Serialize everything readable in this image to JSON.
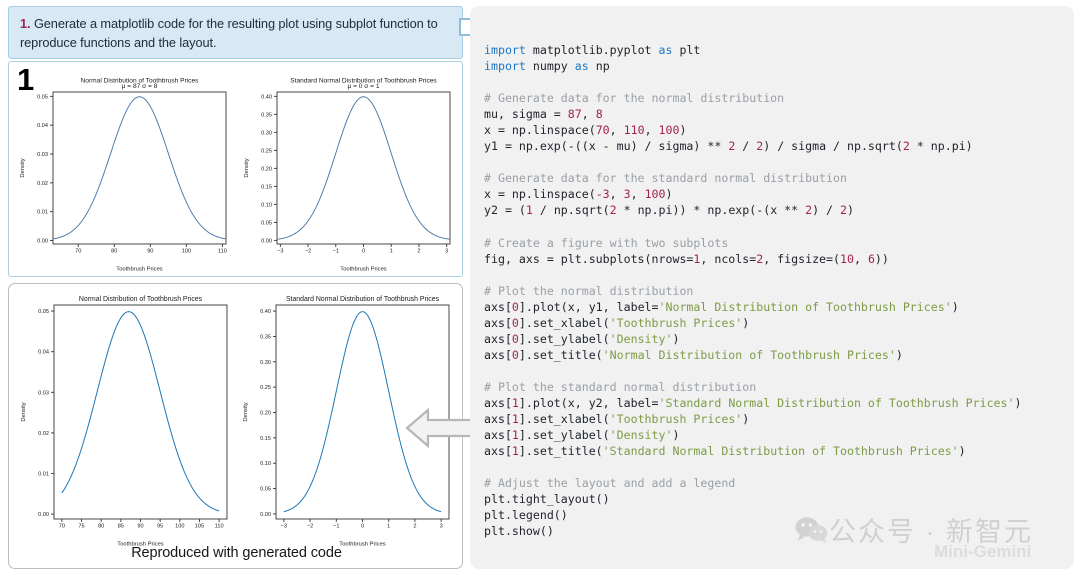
{
  "prompt": {
    "number": "1.",
    "text": " Generate a matplotlib code for the resulting plot using subplot function to reproduce functions and the layout."
  },
  "original_panel": {
    "badge": "1"
  },
  "reproduced_panel": {
    "caption": "Reproduced with generated code"
  },
  "arrows": {
    "right_arrow": "arrow-right-icon",
    "left_arrow": "arrow-left-icon"
  },
  "watermark": {
    "icon": "wechat-icon",
    "main": "公众号 · 新智元",
    "sub": "Mini-Gemini"
  },
  "code": {
    "language": "python",
    "lines": [
      [
        {
          "t": "import",
          "c": "kw"
        },
        {
          "t": " matplotlib.pyplot ",
          "c": "fn"
        },
        {
          "t": "as",
          "c": "kw"
        },
        {
          "t": " plt",
          "c": "fn"
        }
      ],
      [
        {
          "t": "import",
          "c": "kw"
        },
        {
          "t": " numpy ",
          "c": "fn"
        },
        {
          "t": "as",
          "c": "kw"
        },
        {
          "t": " np",
          "c": "fn"
        }
      ],
      [],
      [
        {
          "t": "# Generate data for the normal distribution",
          "c": "cmt"
        }
      ],
      [
        {
          "t": "mu, sigma = ",
          "c": "fn"
        },
        {
          "t": "87",
          "c": "num"
        },
        {
          "t": ", ",
          "c": "fn"
        },
        {
          "t": "8",
          "c": "num"
        }
      ],
      [
        {
          "t": "x = np.linspace(",
          "c": "fn"
        },
        {
          "t": "70",
          "c": "num"
        },
        {
          "t": ", ",
          "c": "fn"
        },
        {
          "t": "110",
          "c": "num"
        },
        {
          "t": ", ",
          "c": "fn"
        },
        {
          "t": "100",
          "c": "num"
        },
        {
          "t": ")",
          "c": "fn"
        }
      ],
      [
        {
          "t": "y1 = np.exp(-((x - mu) / sigma) ** ",
          "c": "fn"
        },
        {
          "t": "2",
          "c": "num"
        },
        {
          "t": " / ",
          "c": "fn"
        },
        {
          "t": "2",
          "c": "num"
        },
        {
          "t": ") / sigma / np.sqrt(",
          "c": "fn"
        },
        {
          "t": "2",
          "c": "num"
        },
        {
          "t": " * np.pi)",
          "c": "fn"
        }
      ],
      [],
      [
        {
          "t": "# Generate data for the standard normal distribution",
          "c": "cmt"
        }
      ],
      [
        {
          "t": "x = np.linspace(",
          "c": "fn"
        },
        {
          "t": "-3",
          "c": "num"
        },
        {
          "t": ", ",
          "c": "fn"
        },
        {
          "t": "3",
          "c": "num"
        },
        {
          "t": ", ",
          "c": "fn"
        },
        {
          "t": "100",
          "c": "num"
        },
        {
          "t": ")",
          "c": "fn"
        }
      ],
      [
        {
          "t": "y2 = (",
          "c": "fn"
        },
        {
          "t": "1",
          "c": "num"
        },
        {
          "t": " / np.sqrt(",
          "c": "fn"
        },
        {
          "t": "2",
          "c": "num"
        },
        {
          "t": " * np.pi)) * np.exp(-(x ** ",
          "c": "fn"
        },
        {
          "t": "2",
          "c": "num"
        },
        {
          "t": ") / ",
          "c": "fn"
        },
        {
          "t": "2",
          "c": "num"
        },
        {
          "t": ")",
          "c": "fn"
        }
      ],
      [],
      [
        {
          "t": "# Create a figure with two subplots",
          "c": "cmt"
        }
      ],
      [
        {
          "t": "fig, axs = plt.subplots(nrows=",
          "c": "fn"
        },
        {
          "t": "1",
          "c": "num"
        },
        {
          "t": ", ncols=",
          "c": "fn"
        },
        {
          "t": "2",
          "c": "num"
        },
        {
          "t": ", figsize=(",
          "c": "fn"
        },
        {
          "t": "10",
          "c": "num"
        },
        {
          "t": ", ",
          "c": "fn"
        },
        {
          "t": "6",
          "c": "num"
        },
        {
          "t": "))",
          "c": "fn"
        }
      ],
      [],
      [
        {
          "t": "# Plot the normal distribution",
          "c": "cmt"
        }
      ],
      [
        {
          "t": "axs[",
          "c": "fn"
        },
        {
          "t": "0",
          "c": "num"
        },
        {
          "t": "].plot(x, y1, label=",
          "c": "fn"
        },
        {
          "t": "'Normal Distribution of Toothbrush Prices'",
          "c": "str"
        },
        {
          "t": ")",
          "c": "fn"
        }
      ],
      [
        {
          "t": "axs[",
          "c": "fn"
        },
        {
          "t": "0",
          "c": "num"
        },
        {
          "t": "].set_xlabel(",
          "c": "fn"
        },
        {
          "t": "'Toothbrush Prices'",
          "c": "str"
        },
        {
          "t": ")",
          "c": "fn"
        }
      ],
      [
        {
          "t": "axs[",
          "c": "fn"
        },
        {
          "t": "0",
          "c": "num"
        },
        {
          "t": "].set_ylabel(",
          "c": "fn"
        },
        {
          "t": "'Density'",
          "c": "str"
        },
        {
          "t": ")",
          "c": "fn"
        }
      ],
      [
        {
          "t": "axs[",
          "c": "fn"
        },
        {
          "t": "0",
          "c": "num"
        },
        {
          "t": "].set_title(",
          "c": "fn"
        },
        {
          "t": "'Normal Distribution of Toothbrush Prices'",
          "c": "str"
        },
        {
          "t": ")",
          "c": "fn"
        }
      ],
      [],
      [
        {
          "t": "# Plot the standard normal distribution",
          "c": "cmt"
        }
      ],
      [
        {
          "t": "axs[",
          "c": "fn"
        },
        {
          "t": "1",
          "c": "num"
        },
        {
          "t": "].plot(x, y2, label=",
          "c": "fn"
        },
        {
          "t": "'Standard Normal Distribution of Toothbrush Prices'",
          "c": "str"
        },
        {
          "t": ")",
          "c": "fn"
        }
      ],
      [
        {
          "t": "axs[",
          "c": "fn"
        },
        {
          "t": "1",
          "c": "num"
        },
        {
          "t": "].set_xlabel(",
          "c": "fn"
        },
        {
          "t": "'Toothbrush Prices'",
          "c": "str"
        },
        {
          "t": ")",
          "c": "fn"
        }
      ],
      [
        {
          "t": "axs[",
          "c": "fn"
        },
        {
          "t": "1",
          "c": "num"
        },
        {
          "t": "].set_ylabel(",
          "c": "fn"
        },
        {
          "t": "'Density'",
          "c": "str"
        },
        {
          "t": ")",
          "c": "fn"
        }
      ],
      [
        {
          "t": "axs[",
          "c": "fn"
        },
        {
          "t": "1",
          "c": "num"
        },
        {
          "t": "].set_title(",
          "c": "fn"
        },
        {
          "t": "'Standard Normal Distribution of Toothbrush Prices'",
          "c": "str"
        },
        {
          "t": ")",
          "c": "fn"
        }
      ],
      [],
      [
        {
          "t": "# Adjust the layout and add a legend",
          "c": "cmt"
        }
      ],
      [
        {
          "t": "plt.tight_layout()",
          "c": "fn"
        }
      ],
      [
        {
          "t": "plt.legend()",
          "c": "fn"
        }
      ],
      [
        {
          "t": "plt.show()",
          "c": "fn"
        }
      ]
    ]
  },
  "chart_data": [
    {
      "id": "orig-normal",
      "type": "line",
      "title": "Normal Distribution of Toothbrush Prices",
      "subtitle": "μ = 87 σ = 8",
      "xlabel": "Toothbrush Prices",
      "ylabel": "Density",
      "line_color": "#4878a8",
      "grid": false,
      "xlim": [
        63,
        111
      ],
      "ylim": [
        -0.0012,
        0.0515
      ],
      "xticks": [
        70,
        80,
        90,
        100,
        110
      ],
      "xticklabels": [
        "70",
        "80",
        "90",
        "100",
        "110"
      ],
      "yticks": [
        0.0,
        0.01,
        0.02,
        0.03,
        0.04,
        0.05
      ],
      "yticklabels": [
        "0.00",
        "0.01",
        "0.02",
        "0.03",
        "0.04",
        "0.05"
      ],
      "curve": {
        "fn": "gaussian",
        "mu": 87,
        "sigma": 8,
        "x_start": 63,
        "x_end": 111,
        "n": 100
      }
    },
    {
      "id": "orig-standard",
      "type": "line",
      "title": "Standard Normal Distribution of Toothbrush Prices",
      "subtitle": "μ = 0 σ = 1",
      "xlabel": "Toothbrush Prices",
      "ylabel": "Density",
      "line_color": "#4878a8",
      "grid": false,
      "xlim": [
        -3.12,
        3.12
      ],
      "ylim": [
        -0.01,
        0.412
      ],
      "xticks": [
        -3,
        -2,
        -1,
        0,
        1,
        2,
        3
      ],
      "xticklabels": [
        "−3",
        "−2",
        "−1",
        "0",
        "1",
        "2",
        "3"
      ],
      "yticks": [
        0.0,
        0.05,
        0.1,
        0.15,
        0.2,
        0.25,
        0.3,
        0.35,
        0.4
      ],
      "yticklabels": [
        "0.00",
        "0.05",
        "0.10",
        "0.15",
        "0.20",
        "0.25",
        "0.30",
        "0.35",
        "0.40"
      ],
      "curve": {
        "fn": "gaussian",
        "mu": 0,
        "sigma": 1,
        "x_start": -3.12,
        "x_end": 3.12,
        "n": 100
      }
    },
    {
      "id": "repro-normal",
      "type": "line",
      "title": "Normal Distribution of Toothbrush Prices",
      "subtitle": "",
      "xlabel": "Toothbrush Prices",
      "ylabel": "Density",
      "line_color": "#1f77b4",
      "grid": false,
      "xlim": [
        68,
        112
      ],
      "ylim": [
        -0.0012,
        0.0515
      ],
      "xticks": [
        70,
        75,
        80,
        85,
        90,
        95,
        100,
        105,
        110
      ],
      "xticklabels": [
        "70",
        "75",
        "80",
        "85",
        "90",
        "95",
        "100",
        "105",
        "110"
      ],
      "yticks": [
        0.0,
        0.01,
        0.02,
        0.03,
        0.04,
        0.05
      ],
      "yticklabels": [
        "0.00",
        "0.01",
        "0.02",
        "0.03",
        "0.04",
        "0.05"
      ],
      "curve": {
        "fn": "gaussian",
        "mu": 87,
        "sigma": 8,
        "x_start": 70,
        "x_end": 110,
        "n": 100
      }
    },
    {
      "id": "repro-standard",
      "type": "line",
      "title": "Standard Normal Distribution of Toothbrush Prices",
      "subtitle": "",
      "xlabel": "Toothbrush Prices",
      "ylabel": "Density",
      "line_color": "#1f77b4",
      "grid": false,
      "xlim": [
        -3.3,
        3.3
      ],
      "ylim": [
        -0.01,
        0.412
      ],
      "xticks": [
        -3,
        -2,
        -1,
        0,
        1,
        2,
        3
      ],
      "xticklabels": [
        "−3",
        "−2",
        "−1",
        "0",
        "1",
        "2",
        "3"
      ],
      "yticks": [
        0.0,
        0.05,
        0.1,
        0.15,
        0.2,
        0.25,
        0.3,
        0.35,
        0.4
      ],
      "yticklabels": [
        "0.00",
        "0.05",
        "0.10",
        "0.15",
        "0.20",
        "0.25",
        "0.30",
        "0.35",
        "0.40"
      ],
      "curve": {
        "fn": "gaussian",
        "mu": 0,
        "sigma": 1,
        "x_start": -3,
        "x_end": 3,
        "n": 100
      }
    }
  ]
}
